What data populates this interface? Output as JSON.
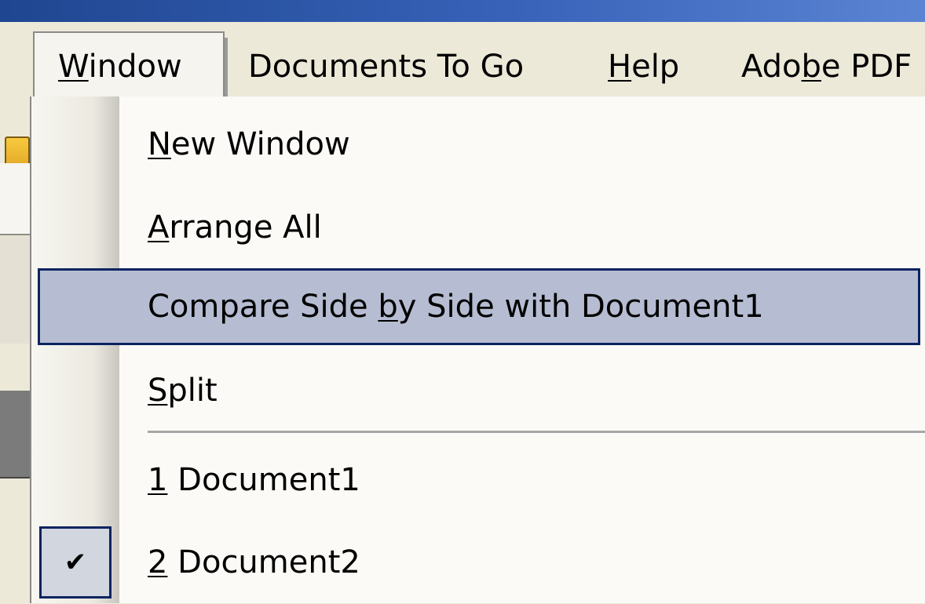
{
  "menubar": {
    "items": [
      {
        "pre": "",
        "mn": "W",
        "post": "indow"
      },
      {
        "pre": "Documents To Go",
        "mn": "",
        "post": ""
      },
      {
        "pre": "",
        "mn": "H",
        "post": "elp"
      },
      {
        "pre": "Ado",
        "mn": "b",
        "post": "e PDF"
      }
    ]
  },
  "dropdown": {
    "items": [
      {
        "pre": "",
        "mn": "N",
        "post": "ew Window"
      },
      {
        "pre": "",
        "mn": "A",
        "post": "rrange All"
      },
      {
        "pre": "Compare Side ",
        "mn": "b",
        "post": "y Side with Document1"
      },
      {
        "pre": "",
        "mn": "S",
        "post": "plit"
      },
      {
        "pre": "",
        "mn": "1",
        "post": " Document1"
      },
      {
        "pre": "",
        "mn": "2",
        "post": " Document2"
      }
    ],
    "check_glyph": "✔"
  },
  "colors": {
    "highlight_fill": "#b6bdd2",
    "highlight_border": "#0a2460",
    "titlebar": "#3762b8"
  }
}
